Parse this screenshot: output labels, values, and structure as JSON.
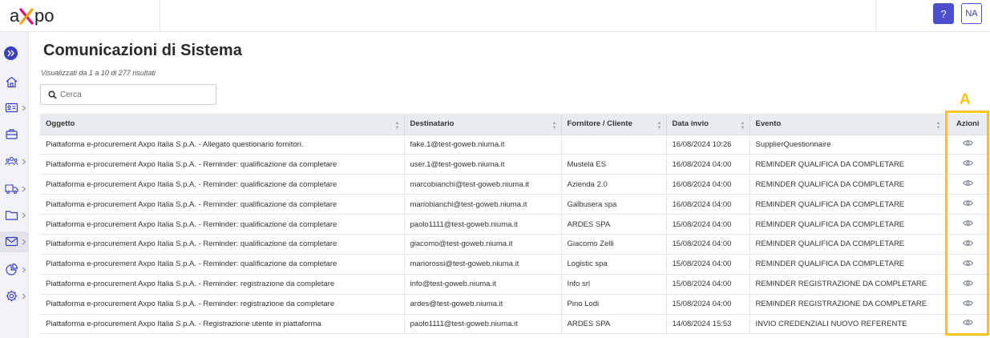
{
  "header": {
    "logo_text": "axpo",
    "help_label": "?",
    "avatar_initials": "NA"
  },
  "sidebar": {
    "items": [
      {
        "icon": "home-icon",
        "chevron": false
      },
      {
        "icon": "id-card-icon",
        "chevron": true
      },
      {
        "icon": "briefcase-icon",
        "chevron": false
      },
      {
        "icon": "users-icon",
        "chevron": true
      },
      {
        "icon": "truck-icon",
        "chevron": true
      },
      {
        "icon": "folder-icon",
        "chevron": true
      },
      {
        "icon": "mail-icon",
        "chevron": true,
        "active": true
      },
      {
        "icon": "pie-chart-icon",
        "chevron": true
      },
      {
        "icon": "gear-icon",
        "chevron": true
      }
    ]
  },
  "main": {
    "title": "Comunicazioni di Sistema",
    "results_text": "Visualizzati da 1 a 10 di 277 risultati",
    "search_placeholder": "Cerca"
  },
  "table": {
    "columns": [
      "Oggetto",
      "Destinatario",
      "Fornitore / Cliente",
      "Data invio",
      "Evento",
      "Azioni"
    ],
    "rows": [
      [
        "Piattaforma e-procurement Axpo Italia S.p.A. - Allegato questionario fornitori.",
        "fake.1@test-goweb.niuma.it",
        "",
        "16/08/2024 10:26",
        "SupplierQuestionnaire"
      ],
      [
        "Piattaforma e-procurement Axpo Italia S.p.A. - Reminder: qualificazione da completare",
        "user.1@test-goweb.niuma.it",
        "Mustela ES",
        "16/08/2024 04:00",
        "REMINDER QUALIFICA DA COMPLETARE"
      ],
      [
        "Piattaforma e-procurement Axpo Italia S.p.A. - Reminder: qualificazione da completare",
        "marcobianchi@test-goweb.niuma.it",
        "Azienda 2.0",
        "16/08/2024 04:00",
        "REMINDER QUALIFICA DA COMPLETARE"
      ],
      [
        "Piattaforma e-procurement Axpo Italia S.p.A. - Reminder: qualificazione da completare",
        "mariobianchi@test-goweb.niuma.it",
        "Galbusera spa",
        "16/08/2024 04:00",
        "REMINDER QUALIFICA DA COMPLETARE"
      ],
      [
        "Piattaforma e-procurement Axpo Italia S.p.A. - Reminder: qualificazione da completare",
        "paolo1111@test-goweb.niuma.it",
        "ARDES SPA",
        "15/08/2024 04:00",
        "REMINDER QUALIFICA DA COMPLETARE"
      ],
      [
        "Piattaforma e-procurement Axpo Italia S.p.A. - Reminder: qualificazione da completare",
        "giacomo@test-goweb.niuma.it",
        "Giacomo Zelli",
        "15/08/2024 04:00",
        "REMINDER QUALIFICA DA COMPLETARE"
      ],
      [
        "Piattaforma e-procurement Axpo Italia S.p.A. - Reminder: qualificazione da completare",
        "mariorossi@test-goweb.niuma.it",
        "Logistic spa",
        "15/08/2024 04:00",
        "REMINDER QUALIFICA DA COMPLETARE"
      ],
      [
        "Piattaforma e-procurement Axpo Italia S.p.A. - Reminder: registrazione da completare",
        "info@test-goweb.niuma.it",
        "Info srl",
        "15/08/2024 04:00",
        "REMINDER REGISTRAZIONE DA COMPLETARE"
      ],
      [
        "Piattaforma e-procurement Axpo Italia S.p.A. - Reminder: registrazione da completare",
        "ardes@test-goweb.niuma.it",
        "Pino Lodi",
        "15/08/2024 04:00",
        "REMINDER REGISTRAZIONE DA COMPLETARE"
      ],
      [
        "Piattaforma e-procurement Axpo Italia S.p.A. - Registrazione utente in piattaforma",
        "paolo1111@test-goweb.niuma.it",
        "ARDES SPA",
        "14/08/2024 15:53",
        "INVIO CREDENZIALI NUOVO REFERENTE"
      ]
    ]
  },
  "annotation": {
    "label": "A",
    "color": "#f5c518"
  },
  "colors": {
    "accent": "#4b4fd0",
    "header_bg": "#e9ecef",
    "sidebar_bg": "#f1f3f6"
  }
}
